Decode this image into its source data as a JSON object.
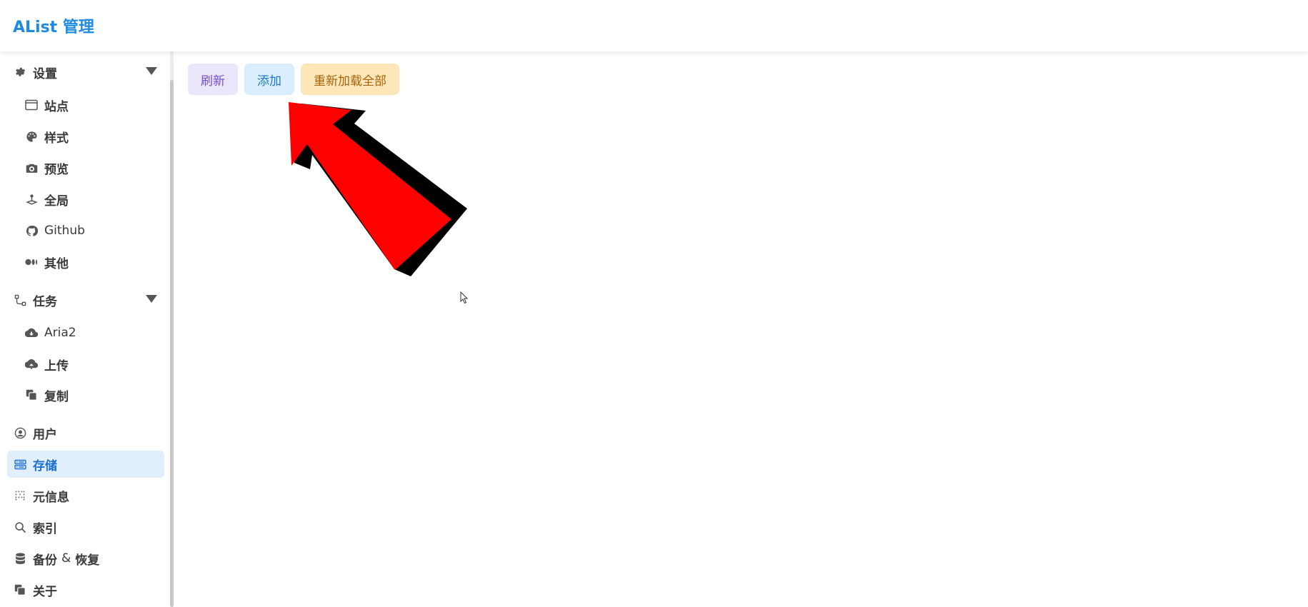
{
  "header": {
    "title": "AList 管理"
  },
  "sidebar": {
    "groups": [
      {
        "label": "设置",
        "icon": "gear-icon",
        "items": [
          {
            "label": "站点",
            "icon": "window-icon"
          },
          {
            "label": "样式",
            "icon": "palette-icon"
          },
          {
            "label": "预览",
            "icon": "camera-icon"
          },
          {
            "label": "全局",
            "icon": "joystick-icon"
          },
          {
            "label": "Github",
            "icon": "github-icon"
          },
          {
            "label": "其他",
            "icon": "dots-icon"
          }
        ]
      },
      {
        "label": "任务",
        "icon": "flow-icon",
        "items": [
          {
            "label": "Aria2",
            "icon": "cloud-download-icon"
          },
          {
            "label": "上传",
            "icon": "cloud-upload-icon"
          },
          {
            "label": "复制",
            "icon": "copy-icon"
          }
        ]
      }
    ],
    "items": [
      {
        "label": "用户",
        "icon": "user-circle-icon"
      },
      {
        "label": "存储",
        "icon": "storage-icon",
        "active": true
      },
      {
        "label": "元信息",
        "icon": "meta-icon"
      },
      {
        "label": "索引",
        "icon": "search-icon"
      },
      {
        "label": "备份",
        "amp": "&",
        "label2": "恢复",
        "icon": "database-icon"
      },
      {
        "label": "关于",
        "icon": "copy-icon"
      }
    ]
  },
  "toolbar": {
    "refresh_label": "刷新",
    "add_label": "添加",
    "reload_label": "重新加载全部"
  },
  "colors": {
    "brand": "#1f8ae0",
    "active_bg": "#e1effc",
    "arrow": "#ff0000"
  }
}
